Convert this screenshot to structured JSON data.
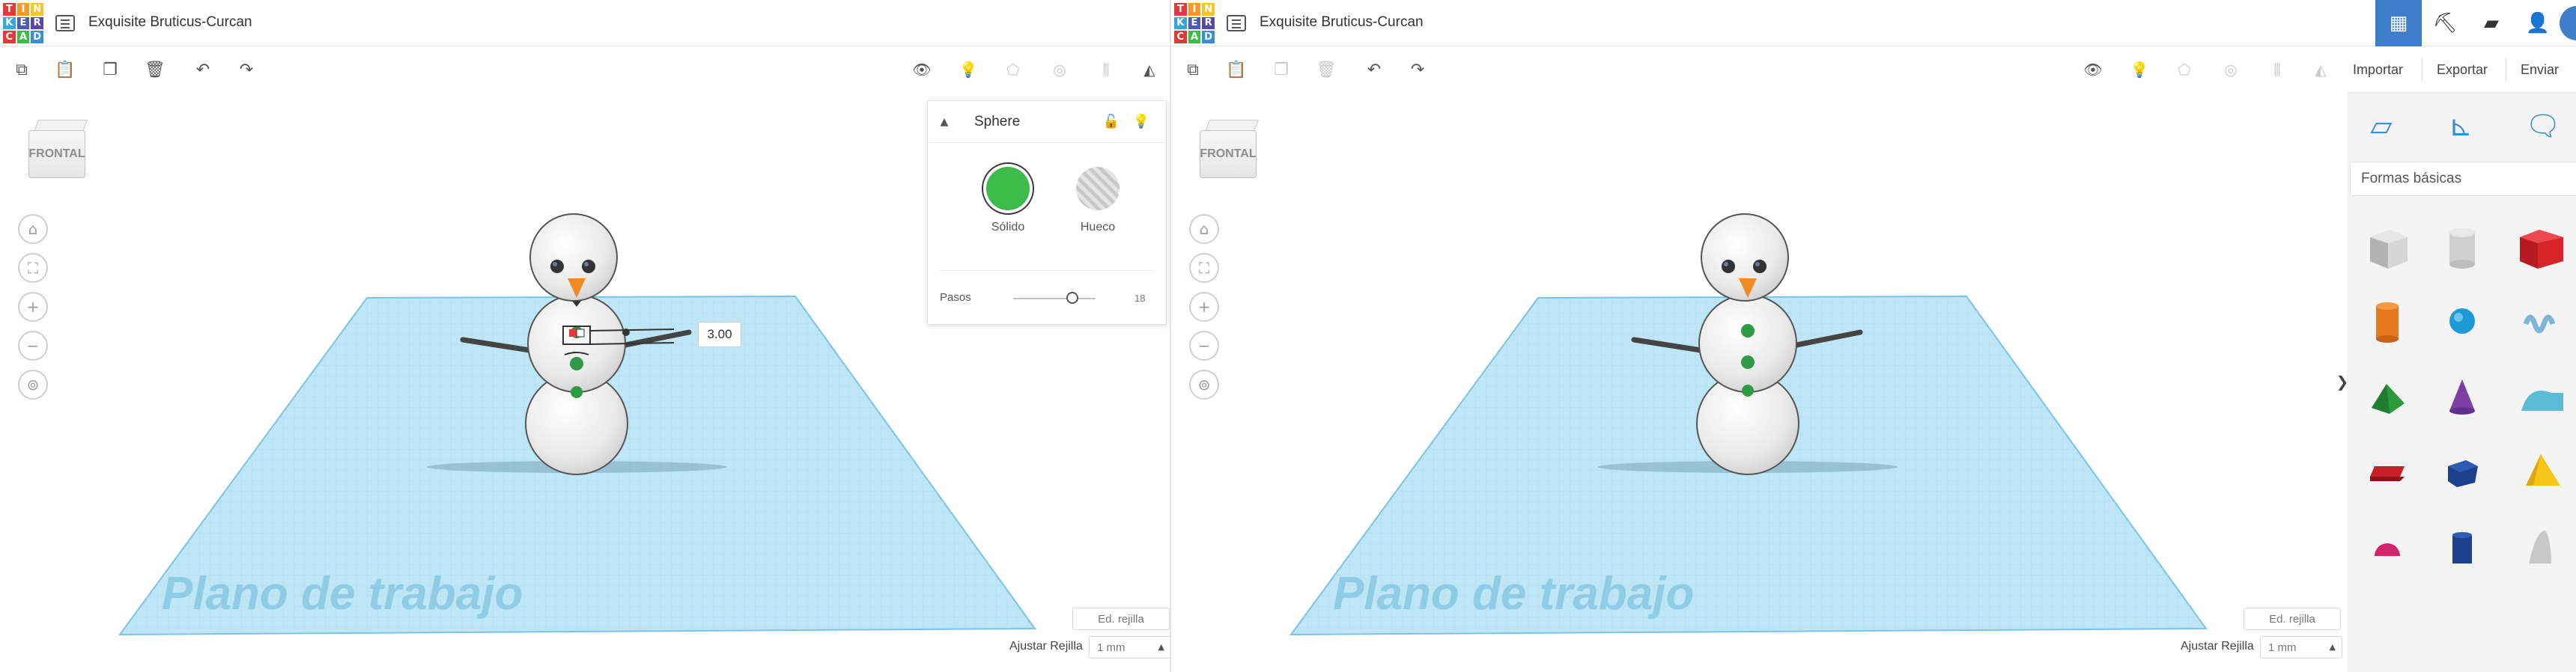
{
  "app": {
    "logo_letters": [
      "T",
      "I",
      "N",
      "K",
      "E",
      "R",
      "C",
      "A",
      "D"
    ],
    "logo_colors": [
      "#e2393b",
      "#f29a2c",
      "#f7c52b",
      "#37a6dd",
      "#4c5bb4",
      "#5a47a8",
      "#e2393b",
      "#3dbb4b",
      "#3a8fd0"
    ]
  },
  "left": {
    "title": "Exquisite Bruticus-Curcan",
    "viewcube_label": "FRONTAL",
    "plane_label": "Plano de trabajo",
    "dimension_value": "3.00",
    "edit_grid_label": "Ed. rejilla",
    "snap_label": "Ajustar Rejilla",
    "snap_value": "1 mm",
    "inspector": {
      "title": "Sphere",
      "solid_label": "Sólido",
      "hole_label": "Hueco",
      "steps_label": "Pasos",
      "steps_value": "18",
      "steps_fraction": 0.72
    }
  },
  "right": {
    "title": "Exquisite Bruticus-Curcan",
    "viewcube_label": "FRONTAL",
    "plane_label": "Plano de trabajo",
    "edit_grid_label": "Ed. rejilla",
    "snap_label": "Ajustar Rejilla",
    "snap_value": "1 mm",
    "actions": {
      "import": "Importar",
      "export": "Exportar",
      "send": "Enviar"
    },
    "shapes_category": "Formas básicas",
    "drawer_toggle": "❯"
  },
  "colors": {
    "accent": "#3f7fc9",
    "grid": "#8fd0ec",
    "solid": "#3dbb4b",
    "carrot": "#f08a24",
    "button_green": "#2f9a44"
  }
}
